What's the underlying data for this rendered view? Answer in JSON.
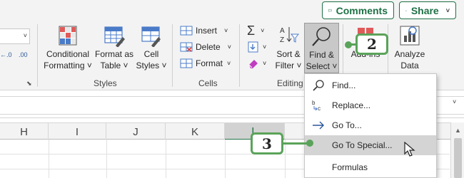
{
  "header": {
    "comments_label": "Comments",
    "share_label": "Share"
  },
  "ribbon": {
    "number_format_dropdown": "",
    "increase_decimal_icon_text": "←.0",
    "decrease_decimal_icon_text": ".00",
    "styles": {
      "conditional_formatting": [
        "Conditional",
        "Formatting ˅"
      ],
      "format_as_table": [
        "Format as",
        "Table ˅"
      ],
      "cell_styles": [
        "Cell",
        "Styles ˅"
      ],
      "group_label": "Styles"
    },
    "cells": {
      "insert": "Insert",
      "delete": "Delete",
      "format": "Format",
      "group_label": "Cells"
    },
    "editing": {
      "sort_filter": [
        "Sort &",
        "Filter ˅"
      ],
      "find_select": [
        "Find &",
        "Select ˅"
      ],
      "group_label": "Editing"
    },
    "addins": {
      "label": "Add-ins"
    },
    "analyze": {
      "label": [
        "Analyze",
        "Data"
      ]
    }
  },
  "grid": {
    "columns": [
      "H",
      "I",
      "J",
      "K",
      "L"
    ],
    "selected_column": "L"
  },
  "find_select_menu": {
    "items": [
      {
        "label": "Find...",
        "icon": "magnifier-icon"
      },
      {
        "label": "Replace...",
        "icon": "replace-icon"
      },
      {
        "label": "Go To...",
        "icon": "arrow-right-icon"
      },
      {
        "label": "Go To Special...",
        "icon": "none",
        "highlighted": true
      },
      {
        "label": "Formulas",
        "icon": "none"
      }
    ]
  },
  "callouts": {
    "step2": "2",
    "step3": "3"
  },
  "colors": {
    "accent_green": "#1e7145",
    "callout_green": "#5aa35a",
    "ribbon_bg": "#f3f3f3",
    "pressed_bg": "#c8c8c8"
  }
}
